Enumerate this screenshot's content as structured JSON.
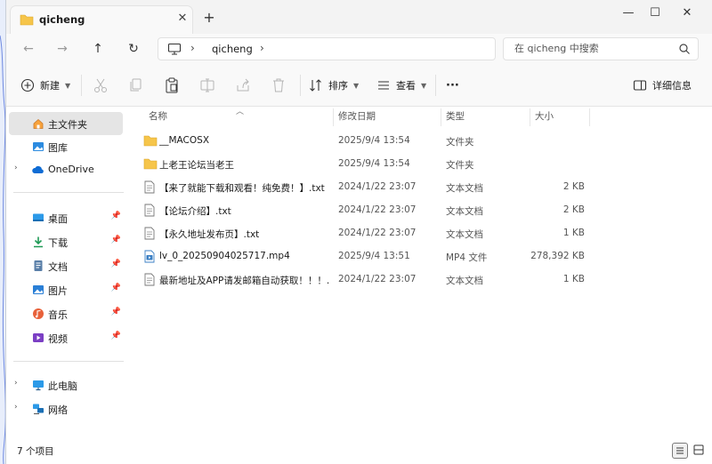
{
  "window": {
    "tab_title": "qicheng",
    "tab_close": "✕",
    "new_tab": "+",
    "minimize": "—",
    "maximize": "☐",
    "close": "✕"
  },
  "nav": {
    "back": "←",
    "forward": "→",
    "up": "↑",
    "refresh": "↻"
  },
  "address": {
    "crumbs": [
      "qicheng"
    ],
    "search_placeholder": "在 qicheng 中搜索"
  },
  "toolbar": {
    "new_label": "新建",
    "sort_label": "排序",
    "view_label": "查看",
    "more_label": "···",
    "details_label": "详细信息",
    "icons": [
      "cut-icon",
      "copy-icon",
      "paste-icon",
      "rename-icon",
      "share-icon",
      "delete-icon"
    ]
  },
  "sidebar": {
    "home": "主文件夹",
    "gallery": "图库",
    "onedrive": "OneDrive",
    "quick": [
      {
        "label": "桌面",
        "icon": "desktop-icon"
      },
      {
        "label": "下载",
        "icon": "download-icon"
      },
      {
        "label": "文档",
        "icon": "document-icon"
      },
      {
        "label": "图片",
        "icon": "picture-icon"
      },
      {
        "label": "音乐",
        "icon": "music-icon"
      },
      {
        "label": "视频",
        "icon": "video-icon"
      }
    ],
    "this_pc": "此电脑",
    "network": "网络"
  },
  "columns": {
    "name": "名称",
    "date": "修改日期",
    "type": "类型",
    "size": "大小"
  },
  "files": [
    {
      "name": "__MACOSX",
      "date": "2025/9/4 13:54",
      "type": "文件夹",
      "size": "",
      "icon": "folder-icon"
    },
    {
      "name": "上老王论坛当老王",
      "date": "2025/9/4 13:54",
      "type": "文件夹",
      "size": "",
      "icon": "folder-icon"
    },
    {
      "name": "【来了就能下载和观看！纯免费！】.txt",
      "date": "2024/1/22 23:07",
      "type": "文本文档",
      "size": "2 KB",
      "icon": "text-file-icon"
    },
    {
      "name": "【论坛介绍】.txt",
      "date": "2024/1/22 23:07",
      "type": "文本文档",
      "size": "2 KB",
      "icon": "text-file-icon"
    },
    {
      "name": "【永久地址发布页】.txt",
      "date": "2024/1/22 23:07",
      "type": "文本文档",
      "size": "1 KB",
      "icon": "text-file-icon"
    },
    {
      "name": "lv_0_20250904025717.mp4",
      "date": "2025/9/4 13:51",
      "type": "MP4 文件",
      "size": "278,392 KB",
      "icon": "video-file-icon"
    },
    {
      "name": "最新地址及APP请发邮箱自动获取！！！....",
      "date": "2024/1/22 23:07",
      "type": "文本文档",
      "size": "1 KB",
      "icon": "text-file-icon"
    }
  ],
  "status": {
    "item_count": "7 个项目"
  },
  "colors": {
    "folder": "#f6c54a",
    "accent": "#0067c0",
    "selected": "#e5e5e5"
  }
}
